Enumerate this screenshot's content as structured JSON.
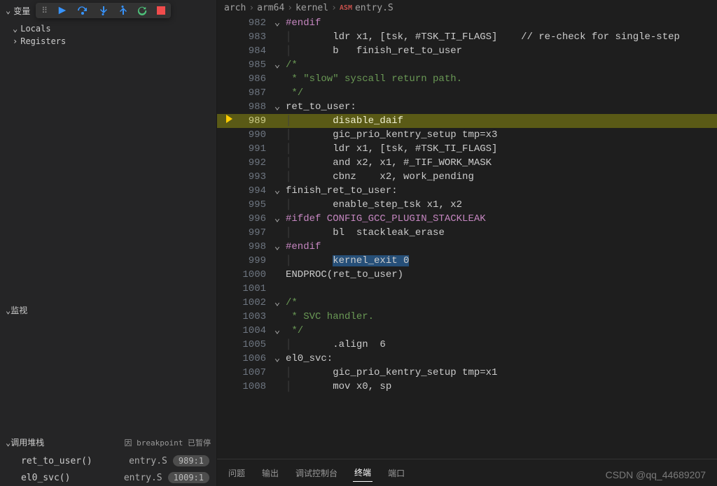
{
  "sidebar": {
    "variables_label": "变量",
    "locals_label": "Locals",
    "registers_label": "Registers",
    "watch_label": "监视",
    "callstack_label": "调用堆栈",
    "callstack_status": "因 breakpoint 已暂停"
  },
  "callstack": [
    {
      "func": "ret_to_user()",
      "file": "entry.S",
      "pos": "989:1"
    },
    {
      "func": "el0_svc()",
      "file": "entry.S",
      "pos": "1009:1"
    }
  ],
  "breadcrumb": {
    "p1": "arch",
    "p2": "arm64",
    "p3": "kernel",
    "asm_tag": "ASM",
    "file": "entry.S"
  },
  "code": [
    {
      "n": 982,
      "fold": "v",
      "indent": 0,
      "text": "#endif",
      "cls": "directive"
    },
    {
      "n": 983,
      "fold": "",
      "indent": 2,
      "text": "ldr x1, [tsk, #TSK_TI_FLAGS]    // re-check for single-step"
    },
    {
      "n": 984,
      "fold": "",
      "indent": 2,
      "text": "b   finish_ret_to_user"
    },
    {
      "n": 985,
      "fold": "v",
      "indent": 0,
      "text": "/*",
      "cls": "comment"
    },
    {
      "n": 986,
      "fold": "",
      "indent": 0,
      "text": " * \"slow\" syscall return path.",
      "cls": "comment"
    },
    {
      "n": 987,
      "fold": "",
      "indent": 0,
      "text": " */",
      "cls": "comment"
    },
    {
      "n": 988,
      "fold": "v",
      "indent": 0,
      "text": "ret_to_user:"
    },
    {
      "n": 989,
      "fold": "",
      "indent": 2,
      "text": "disable_daif",
      "current": true
    },
    {
      "n": 990,
      "fold": "",
      "indent": 2,
      "text": "gic_prio_kentry_setup tmp=x3"
    },
    {
      "n": 991,
      "fold": "",
      "indent": 2,
      "text": "ldr x1, [tsk, #TSK_TI_FLAGS]"
    },
    {
      "n": 992,
      "fold": "",
      "indent": 2,
      "text": "and x2, x1, #_TIF_WORK_MASK"
    },
    {
      "n": 993,
      "fold": "",
      "indent": 2,
      "text": "cbnz    x2, work_pending"
    },
    {
      "n": 994,
      "fold": "v",
      "indent": 0,
      "text": "finish_ret_to_user:"
    },
    {
      "n": 995,
      "fold": "",
      "indent": 2,
      "text": "enable_step_tsk x1, x2"
    },
    {
      "n": 996,
      "fold": "v",
      "indent": 0,
      "text": "#ifdef CONFIG_GCC_PLUGIN_STACKLEAK",
      "cls": "directive"
    },
    {
      "n": 997,
      "fold": "",
      "indent": 2,
      "text": "bl  stackleak_erase"
    },
    {
      "n": 998,
      "fold": "v",
      "indent": 0,
      "text": "#endif",
      "cls": "directive"
    },
    {
      "n": 999,
      "fold": "",
      "indent": 2,
      "text": "kernel_exit 0",
      "selected": true
    },
    {
      "n": 1000,
      "fold": "",
      "indent": 0,
      "text": "ENDPROC(ret_to_user)"
    },
    {
      "n": 1001,
      "fold": "",
      "indent": 0,
      "text": ""
    },
    {
      "n": 1002,
      "fold": "v",
      "indent": 0,
      "text": "/*",
      "cls": "comment"
    },
    {
      "n": 1003,
      "fold": "",
      "indent": 0,
      "text": " * SVC handler.",
      "cls": "comment"
    },
    {
      "n": 1004,
      "fold": "v",
      "indent": 0,
      "text": " */",
      "cls": "comment"
    },
    {
      "n": 1005,
      "fold": "",
      "indent": 2,
      "text": ".align  6"
    },
    {
      "n": 1006,
      "fold": "v",
      "indent": 0,
      "text": "el0_svc:"
    },
    {
      "n": 1007,
      "fold": "",
      "indent": 2,
      "text": "gic_prio_kentry_setup tmp=x1"
    },
    {
      "n": 1008,
      "fold": "",
      "indent": 2,
      "text": "mov x0, sp"
    }
  ],
  "bottom_tabs": {
    "problems": "问题",
    "output": "输出",
    "debug_console": "调试控制台",
    "terminal": "终端",
    "ports": "端口"
  },
  "watermark": "CSDN @qq_44689207"
}
